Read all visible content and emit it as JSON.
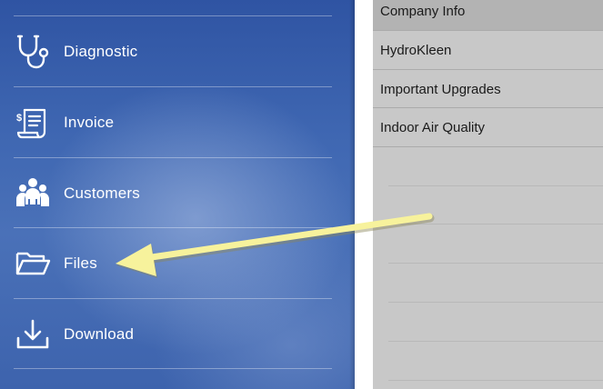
{
  "menu": {
    "items": [
      {
        "label": "Diagnostic",
        "icon": "stethoscope-icon"
      },
      {
        "label": "Invoice",
        "icon": "invoice-icon"
      },
      {
        "label": "Customers",
        "icon": "customers-icon"
      },
      {
        "label": "Files",
        "icon": "folder-icon"
      },
      {
        "label": "Download",
        "icon": "download-icon"
      }
    ]
  },
  "list": {
    "selected_index": 0,
    "items": [
      {
        "label": "Company Info"
      },
      {
        "label": "HydroKleen"
      },
      {
        "label": "Important Upgrades"
      },
      {
        "label": "Indoor Air Quality"
      }
    ]
  },
  "annotation": {
    "arrow_color": "#f7f29c",
    "points_to": "Files"
  },
  "colors": {
    "menu_background": "#3f67b2",
    "list_background": "#c8c8c8",
    "list_selected": "#b3b3b3"
  }
}
